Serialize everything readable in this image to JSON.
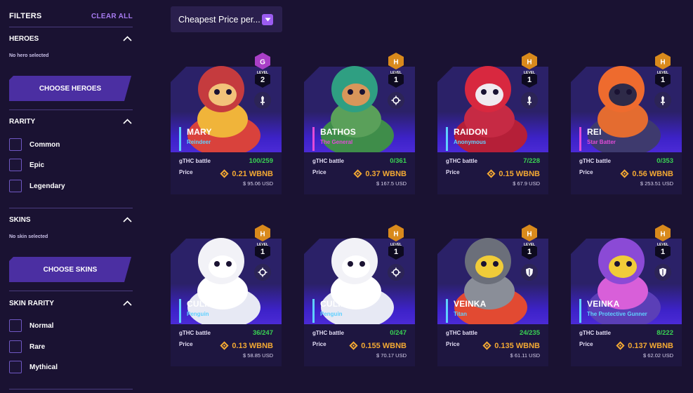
{
  "filters": {
    "title": "FILTERS",
    "clear_all": "CLEAR ALL",
    "heroes": {
      "title": "HEROES",
      "note": "No hero selected",
      "button": "CHOOSE HEROES"
    },
    "rarity": {
      "title": "RARITY",
      "options": [
        "Common",
        "Epic",
        "Legendary"
      ]
    },
    "skins": {
      "title": "SKINS",
      "note": "No skin selected",
      "button": "CHOOSE SKINS"
    },
    "skin_rarity": {
      "title": "SKIN RARITY",
      "options": [
        "Normal",
        "Rare",
        "Mythical"
      ]
    }
  },
  "sort": {
    "selected": "Cheapest Price per..."
  },
  "labels": {
    "battle": "gTHC battle",
    "price": "Price",
    "level_caption": "LEVEL"
  },
  "colors": {
    "accent": "#9b5cf0",
    "battle_green": "#39d353",
    "price_orange": "#f3a933",
    "name_accent_cyan": "#5fd0ff",
    "name_accent_magenta": "#e24bd8"
  },
  "cards": [
    {
      "name": "MARY",
      "subtitle": "Reindeer",
      "badge": "G",
      "badge_color": "#a93fc7",
      "level": "2",
      "role_icon": "sword-icon",
      "battle": "100/259",
      "price": "0.21 WBNB",
      "usd": "$ 95.06 USD",
      "accent": "#5fd0ff"
    },
    {
      "name": "BATHOS",
      "subtitle": "The General",
      "badge": "H",
      "badge_color": "#d98a1c",
      "level": "1",
      "role_icon": "crosshair-icon",
      "battle": "0/361",
      "price": "0.37 WBNB",
      "usd": "$ 167.5 USD",
      "accent": "#e24bd8"
    },
    {
      "name": "RAIDON",
      "subtitle": "Anonymous",
      "badge": "H",
      "badge_color": "#d98a1c",
      "level": "1",
      "role_icon": "sword-icon",
      "battle": "7/228",
      "price": "0.15 WBNB",
      "usd": "$ 67.9 USD",
      "accent": "#5fd0ff"
    },
    {
      "name": "REI",
      "subtitle": "Star Batter",
      "badge": "H",
      "badge_color": "#d98a1c",
      "level": "1",
      "role_icon": "sword-icon",
      "battle": "0/353",
      "price": "0.56 WBNB",
      "usd": "$ 253.51 USD",
      "accent": "#e24bd8"
    },
    {
      "name": "CULIEN",
      "subtitle": "Penguin",
      "badge": "H",
      "badge_color": "#d98a1c",
      "level": "1",
      "role_icon": "crosshair-icon",
      "battle": "36/247",
      "price": "0.13 WBNB",
      "usd": "$ 58.85 USD",
      "accent": "#5fd0ff"
    },
    {
      "name": "CULIEN",
      "subtitle": "Penguin",
      "badge": "H",
      "badge_color": "#d98a1c",
      "level": "1",
      "role_icon": "crosshair-icon",
      "battle": "0/247",
      "price": "0.155 WBNB",
      "usd": "$ 70.17 USD",
      "accent": "#5fd0ff"
    },
    {
      "name": "VEINKA",
      "subtitle": "Titan",
      "badge": "H",
      "badge_color": "#d98a1c",
      "level": "1",
      "role_icon": "shield-icon",
      "battle": "24/235",
      "price": "0.135 WBNB",
      "usd": "$ 61.11 USD",
      "accent": "#5fd0ff"
    },
    {
      "name": "VEINKA",
      "subtitle": "The Protective Gunner",
      "badge": "H",
      "badge_color": "#d98a1c",
      "level": "1",
      "role_icon": "shield-icon",
      "battle": "8/222",
      "price": "0.137 WBNB",
      "usd": "$ 62.02 USD",
      "accent": "#5fd0ff"
    }
  ]
}
